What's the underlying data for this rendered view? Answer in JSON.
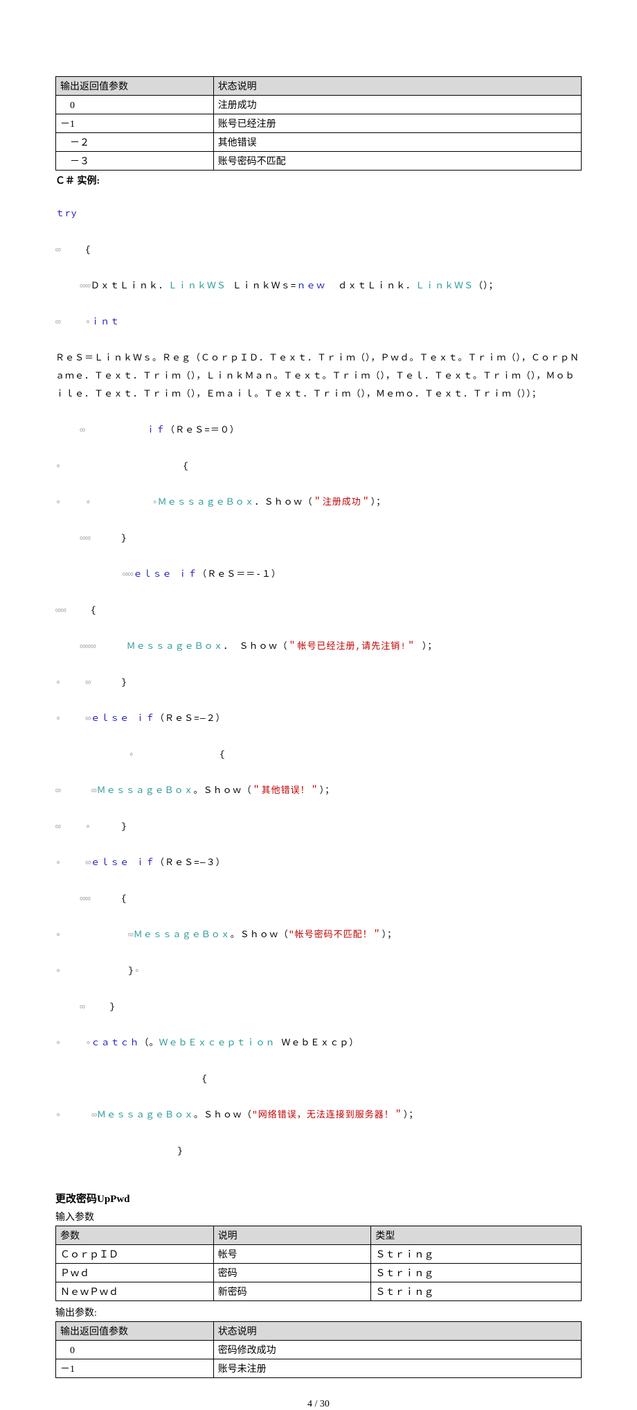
{
  "table1": {
    "headers": [
      "输出返回值参数",
      "状态说明"
    ],
    "rows": [
      [
        "　0",
        "注册成功"
      ],
      [
        "－1",
        "账号已经注册"
      ],
      [
        "　－２",
        "其他错误"
      ],
      [
        "　－３",
        "账号密码不匹配"
      ]
    ]
  },
  "csharp_title": "Ｃ＃ 实例:",
  "code": {
    "l1_kw": "ｔry",
    "l2": "    {",
    "l3a": "ＤｘｔＬｉｎｋ．",
    "l3b": "ＬｉｎｋＷＳ",
    "l3c": " ＬｉｎｋＷｓ=",
    "l3d": "ｎｅｗ",
    "l3e": "  ｄｘｔＬｉｎｋ．",
    "l3f": "ＬｉｎｋＷＳ",
    "l3g": "（）；",
    "l4_kw": "ｉｎｔ",
    "l5": "ＲｅＳ＝ＬｉｎｋＷｓ。Ｒｅｇ（ＣｏｒｐＩＤ．Ｔｅｘｔ．Ｔｒｉｍ（），Ｐｗｄ。Ｔｅｘｔ。Ｔｒｉｍ（），ＣｏｒｐＮａｍｅ．Ｔｅｘｔ．Ｔｒｉｍ（），ＬｉｎｋＭａｎ。Ｔｅｘｔ。Ｔｒｉｍ（），Ｔｅｌ．Ｔｅｘｔ。Ｔｒｉｍ（），Ｍｏｂｉｌｅ．Ｔｅｘｔ．Ｔｒｉｍ（），Ｅｍａｉｌ。Ｔｅｘｔ．Ｔｒｉｍ（），Ｍｅｍｏ．Ｔｅｘｔ．Ｔｒｉｍ（））；",
    "l6a": "          ",
    "l6_kw": "ｉｆ",
    "l6b": "（ＲｅＳ=＝０）",
    "l7": "                    {",
    "l8a": "          ",
    "l8_ty": "ＭｅｓｓａｇｅＢｏｘ",
    "l8b": "．Ｓｈｏｗ（",
    "l8_str": "＂注册成功＂",
    "l8c": "）；",
    "l9": "     }",
    "l10a": "           ",
    "l10_kw": "ｅｌｓｅ ｉｆ",
    "l10b": "（ＲｅＳ＝＝-１）",
    "l11": "    {",
    "l12a": "     ",
    "l12_ty": "ＭｅｓｓａｇｅＢｏｘ",
    "l12b": "． Ｓｈｏｗ（",
    "l12_str": "＂帐号已经注册,请先注销!＂",
    "l12c": " ）；",
    "l13": "     }",
    "l14a": "    ",
    "l14_kw": "ｅｌｓｅ ｉｆ",
    "l14b": "（ＲｅＳ=—２）",
    "l15": "              {",
    "l16a": "     ",
    "l16_ty": "ＭｅｓｓａｇｅＢｏｘ",
    "l16b": "。Ｓｈｏｗ（",
    "l16_str": "＂其他错误！＂",
    "l16c": "）；",
    "l17": "     }",
    "l18a": "    ",
    "l18_kw": "ｅｌｓｅ ｉｆ",
    "l18b": "（ＲｅＳ=—３）",
    "l19": "     {",
    "l20a": "           ",
    "l20_ty": "ＭｅｓｓａｇｅＢｏｘ",
    "l20b": "。Ｓｈｏｗ（",
    "l20_str": "\"帐号密码不匹配！＂",
    "l20c": "）；",
    "l21": "           }",
    "l22": "    }",
    "l23a": "    ",
    "l23_kw": "ｃａｔｃｈ",
    "l23b": "（。",
    "l23_ty": "ＷｅｂＥｘｃｅｐｔｉｏｎ",
    "l23c": " ＷｅｂＥｘｃｐ）",
    "l24": "                        {",
    "l25a": "     ",
    "l25_ty": "ＭｅｓｓａｇｅＢｏｘ",
    "l25b": "。Ｓｈｏｗ（",
    "l25_str": "\"网络错误，无法连接到服务器！＂",
    "l25c": "）；",
    "l26": "                    }"
  },
  "section2_title": "更改密码UpPwd",
  "input_params_title": "输入参数",
  "table2": {
    "headers": [
      "参数",
      "说明",
      "类型"
    ],
    "rows": [
      [
        "ＣｏｒｐＩＤ",
        "帐号",
        "Ｓｔｒｉｎｇ"
      ],
      [
        "Ｐｗｄ",
        "密码",
        "Ｓｔｒｉｎｇ"
      ],
      [
        "ＮｅｗＰｗｄ",
        "新密码",
        "Ｓｔｒｉｎｇ"
      ]
    ]
  },
  "output_params_title": "输出参数:",
  "table3": {
    "headers": [
      "输出返回值参数",
      "状态说明"
    ],
    "rows": [
      [
        "　0",
        "密码修改成功"
      ],
      [
        "－1",
        "账号未注册"
      ]
    ]
  },
  "footer": "4 / 30"
}
